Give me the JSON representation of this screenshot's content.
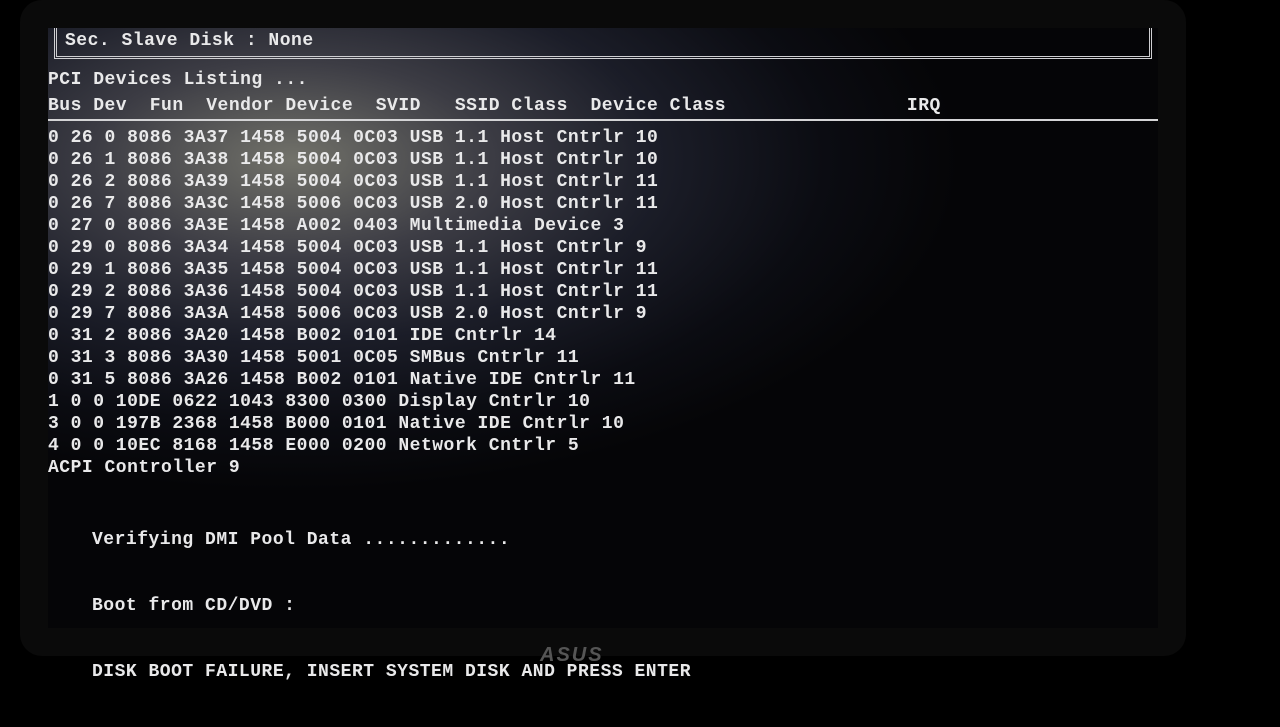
{
  "topbox": {
    "line": " Sec. Slave  Disk  : None"
  },
  "title": "PCI Devices Listing ...",
  "columns": [
    "Bus",
    "Dev",
    "Fun",
    "Vendor",
    "Device",
    "SVID",
    "SSID",
    "Class",
    "Device Class",
    "IRQ"
  ],
  "widths": [
    4,
    5,
    5,
    7,
    7,
    6,
    6,
    6,
    22,
    4
  ],
  "rows": [
    {
      "bus": "0",
      "dev": "26",
      "fun": "0",
      "vendor": "8086",
      "device": "3A37",
      "svid": "1458",
      "ssid": "5004",
      "cls": "0C03",
      "dclass": "USB 1.1 Host Cntrlr",
      "irq": "10"
    },
    {
      "bus": "0",
      "dev": "26",
      "fun": "1",
      "vendor": "8086",
      "device": "3A38",
      "svid": "1458",
      "ssid": "5004",
      "cls": "0C03",
      "dclass": "USB 1.1 Host Cntrlr",
      "irq": "10"
    },
    {
      "bus": "0",
      "dev": "26",
      "fun": "2",
      "vendor": "8086",
      "device": "3A39",
      "svid": "1458",
      "ssid": "5004",
      "cls": "0C03",
      "dclass": "USB 1.1 Host Cntrlr",
      "irq": "11"
    },
    {
      "bus": "0",
      "dev": "26",
      "fun": "7",
      "vendor": "8086",
      "device": "3A3C",
      "svid": "1458",
      "ssid": "5006",
      "cls": "0C03",
      "dclass": "USB 2.0 Host Cntrlr",
      "irq": "11"
    },
    {
      "bus": "0",
      "dev": "27",
      "fun": "0",
      "vendor": "8086",
      "device": "3A3E",
      "svid": "1458",
      "ssid": "A002",
      "cls": "0403",
      "dclass": "Multimedia Device",
      "irq": "3"
    },
    {
      "bus": "0",
      "dev": "29",
      "fun": "0",
      "vendor": "8086",
      "device": "3A34",
      "svid": "1458",
      "ssid": "5004",
      "cls": "0C03",
      "dclass": "USB 1.1 Host Cntrlr",
      "irq": "9"
    },
    {
      "bus": "0",
      "dev": "29",
      "fun": "1",
      "vendor": "8086",
      "device": "3A35",
      "svid": "1458",
      "ssid": "5004",
      "cls": "0C03",
      "dclass": "USB 1.1 Host Cntrlr",
      "irq": "11"
    },
    {
      "bus": "0",
      "dev": "29",
      "fun": "2",
      "vendor": "8086",
      "device": "3A36",
      "svid": "1458",
      "ssid": "5004",
      "cls": "0C03",
      "dclass": "USB 1.1 Host Cntrlr",
      "irq": "11"
    },
    {
      "bus": "0",
      "dev": "29",
      "fun": "7",
      "vendor": "8086",
      "device": "3A3A",
      "svid": "1458",
      "ssid": "5006",
      "cls": "0C03",
      "dclass": "USB 2.0 Host Cntrlr",
      "irq": "9"
    },
    {
      "bus": "0",
      "dev": "31",
      "fun": "2",
      "vendor": "8086",
      "device": "3A20",
      "svid": "1458",
      "ssid": "B002",
      "cls": "0101",
      "dclass": "IDE Cntrlr",
      "irq": "14"
    },
    {
      "bus": "0",
      "dev": "31",
      "fun": "3",
      "vendor": "8086",
      "device": "3A30",
      "svid": "1458",
      "ssid": "5001",
      "cls": "0C05",
      "dclass": "SMBus Cntrlr",
      "irq": "11"
    },
    {
      "bus": "0",
      "dev": "31",
      "fun": "5",
      "vendor": "8086",
      "device": "3A26",
      "svid": "1458",
      "ssid": "B002",
      "cls": "0101",
      "dclass": "Native IDE Cntrlr",
      "irq": "11"
    },
    {
      "bus": "1",
      "dev": "0",
      "fun": "0",
      "vendor": "10DE",
      "device": "0622",
      "svid": "1043",
      "ssid": "8300",
      "cls": "0300",
      "dclass": "Display Cntrlr",
      "irq": "10"
    },
    {
      "bus": "3",
      "dev": "0",
      "fun": "0",
      "vendor": "197B",
      "device": "2368",
      "svid": "1458",
      "ssid": "B000",
      "cls": "0101",
      "dclass": "Native IDE Cntrlr",
      "irq": "10"
    },
    {
      "bus": "4",
      "dev": "0",
      "fun": "0",
      "vendor": "10EC",
      "device": "8168",
      "svid": "1458",
      "ssid": "E000",
      "cls": "0200",
      "dclass": "Network Cntrlr",
      "irq": "5"
    },
    {
      "bus": "",
      "dev": "",
      "fun": "",
      "vendor": "",
      "device": "",
      "svid": "",
      "ssid": "",
      "cls": "",
      "dclass": "ACPI Controller",
      "irq": "9"
    }
  ],
  "boot": {
    "line1": "Verifying DMI Pool Data .............",
    "line2": "Boot from CD/DVD :",
    "line3": "DISK BOOT FAILURE, INSERT SYSTEM DISK AND PRESS ENTER"
  },
  "brand": "ASUS"
}
